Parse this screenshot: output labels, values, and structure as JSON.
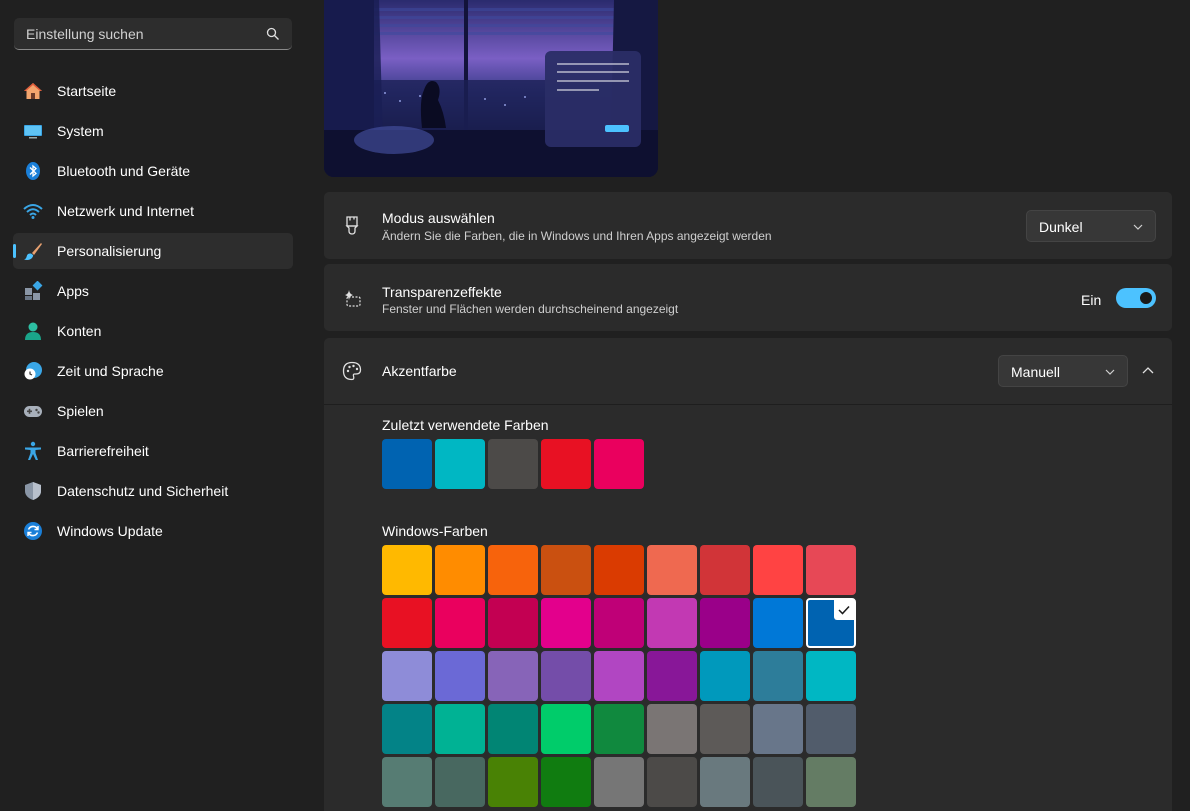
{
  "search": {
    "placeholder": "Einstellung suchen",
    "icon": "search-icon"
  },
  "sidebar": {
    "items": [
      {
        "label": "Startseite",
        "icon": "home-icon"
      },
      {
        "label": "System",
        "icon": "system-monitor-icon"
      },
      {
        "label": "Bluetooth und Geräte",
        "icon": "bluetooth-icon"
      },
      {
        "label": "Netzwerk und Internet",
        "icon": "wifi-icon"
      },
      {
        "label": "Personalisierung",
        "icon": "paintbrush-icon",
        "active": true
      },
      {
        "label": "Apps",
        "icon": "apps-icon"
      },
      {
        "label": "Konten",
        "icon": "account-icon"
      },
      {
        "label": "Zeit und Sprache",
        "icon": "clock-globe-icon"
      },
      {
        "label": "Spielen",
        "icon": "gamepad-icon"
      },
      {
        "label": "Barrierefreiheit",
        "icon": "accessibility-icon"
      },
      {
        "label": "Datenschutz und Sicherheit",
        "icon": "shield-icon"
      },
      {
        "label": "Windows Update",
        "icon": "update-icon"
      }
    ]
  },
  "mode": {
    "title": "Modus auswählen",
    "subtitle": "Ändern Sie die Farben, die in Windows und Ihren Apps angezeigt werden",
    "value": "Dunkel"
  },
  "transparency": {
    "title": "Transparenzeffekte",
    "subtitle": "Fenster und Flächen werden durchscheinend angezeigt",
    "state_label": "Ein",
    "on": true
  },
  "accent": {
    "title": "Akzentfarbe",
    "value": "Manuell",
    "recent_label": "Zuletzt verwendete Farben",
    "recent_colors": [
      "#0063b1",
      "#00b7c3",
      "#4c4a48",
      "#e81123",
      "#ea005e"
    ],
    "windows_label": "Windows-Farben",
    "windows_colors": [
      [
        "#ffb900",
        "#ff8c00",
        "#f7630c",
        "#ca5010",
        "#da3b01",
        "#ef6950",
        "#d13438",
        "#ff4343",
        "#e74856"
      ],
      [
        "#e81123",
        "#ea005e",
        "#c30052",
        "#e3008c",
        "#bf0077",
        "#c239b3",
        "#9a0089",
        "#0078d7",
        "#0063b1"
      ],
      [
        "#8e8cd8",
        "#6b69d6",
        "#8764b8",
        "#744da9",
        "#b146c2",
        "#881798",
        "#0099bc",
        "#2d7d9a",
        "#00b7c3"
      ],
      [
        "#038387",
        "#00b294",
        "#018574",
        "#00cc6a",
        "#10893e",
        "#7a7574",
        "#5d5a58",
        "#68768a",
        "#515c6b"
      ],
      [
        "#567c73",
        "#486860",
        "#498205",
        "#107c10",
        "#767676",
        "#4c4a48",
        "#69797e",
        "#4a5459",
        "#647c64"
      ]
    ],
    "selected": [
      1,
      8
    ]
  },
  "colors": {
    "accent": "#4cc2ff",
    "card": "#2b2b2b",
    "background": "#202020"
  }
}
